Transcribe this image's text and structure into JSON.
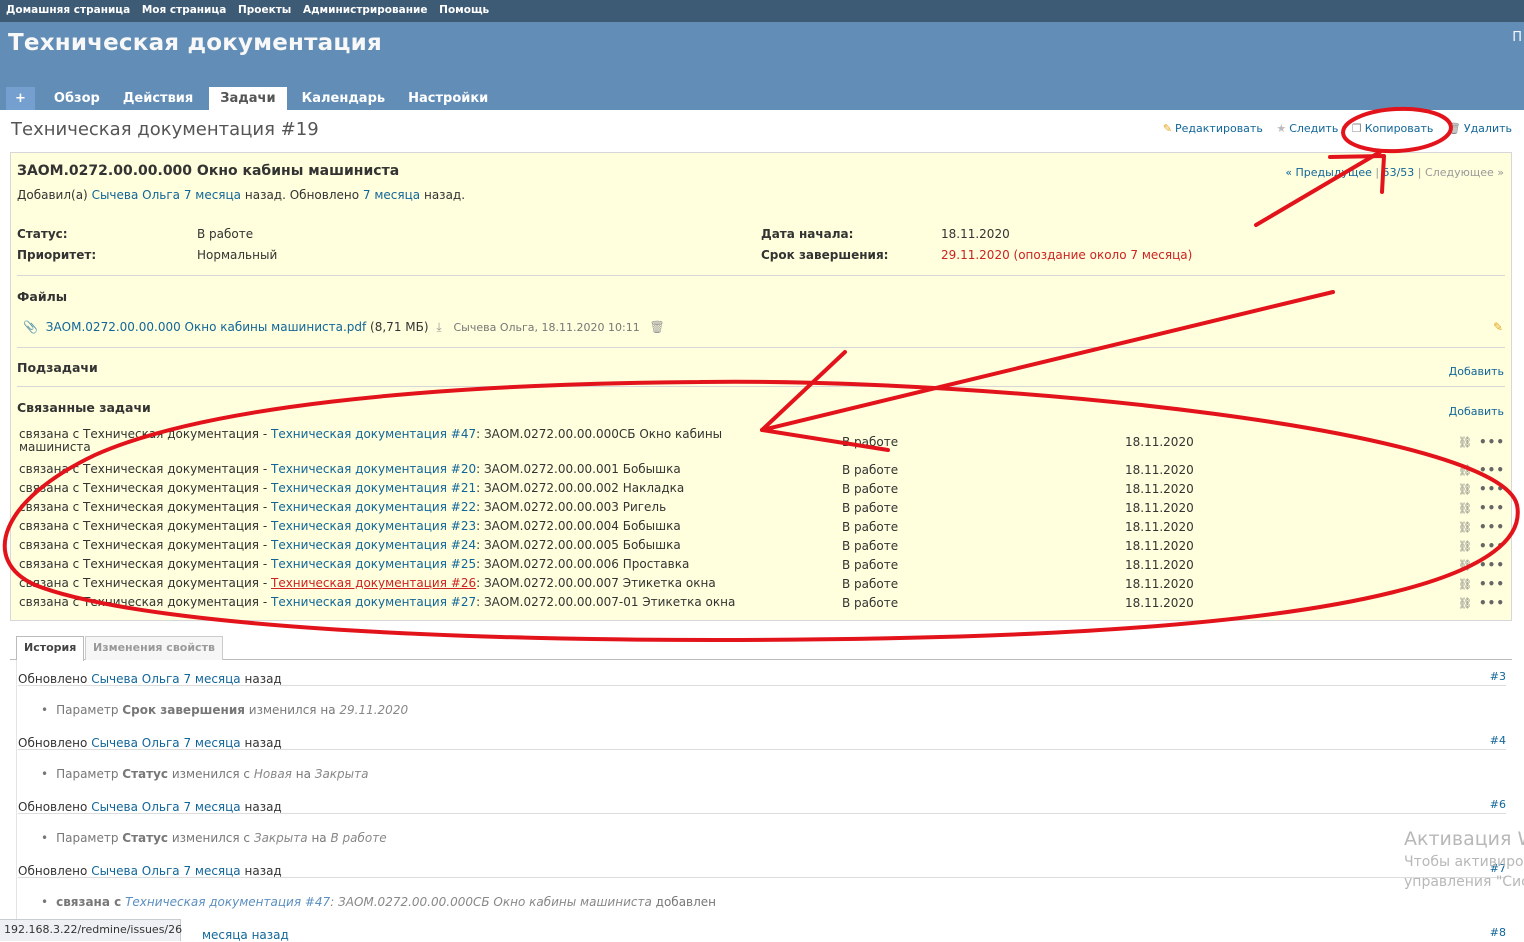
{
  "top_menu": {
    "items": [
      "Домашняя страница",
      "Моя страница",
      "Проекты",
      "Администрирование",
      "Помощь"
    ]
  },
  "header": {
    "project_title": "Техническая документация",
    "edge_text": "П",
    "tabs": [
      "+",
      "Обзор",
      "Действия",
      "Задачи",
      "Календарь",
      "Настройки"
    ],
    "active_tab": "Задачи"
  },
  "issue": {
    "page_title": "Техническая документация #19",
    "actions": {
      "edit": "Редактировать",
      "watch": "Следить",
      "copy": "Копировать",
      "delete": "Удалить"
    },
    "subject": "ЗАОМ.0272.00.00.000 Окно кабины машиниста",
    "nav": {
      "prev": "« Предыдущее",
      "sep1": "|",
      "position": "53/53",
      "sep2": "|",
      "next": "Следующее »"
    },
    "author": {
      "prefix": "Добавил(а)",
      "name": "Сычева Ольга",
      "created": "7 месяца",
      "mid": "назад. Обновлено",
      "updated": "7 месяца",
      "suffix": "назад."
    },
    "attributes": {
      "status_label": "Статус:",
      "status": "В работе",
      "priority_label": "Приоритет:",
      "priority": "Нормальный",
      "start_label": "Дата начала:",
      "start": "18.11.2020",
      "due_label": "Срок завершения:",
      "due": "29.11.2020 (опоздание около 7 месяца)"
    },
    "files": {
      "title": "Файлы",
      "name": "ЗАОМ.0272.00.00.000 Окно кабины машиниста.pdf",
      "size": "(8,71 МБ)",
      "meta": "Сычева Ольга, 18.11.2020 10:11"
    },
    "subtasks": {
      "title": "Подзадачи",
      "add": "Добавить"
    },
    "related": {
      "title": "Связанные задачи",
      "add": "Добавить",
      "rows": [
        {
          "rel": "связана с Техническая документация - ",
          "link": "Техническая документация #47",
          "subject": ": ЗАОМ.0272.00.00.000СБ Окно кабины",
          "subject2": "машиниста",
          "status": "В работе",
          "date": "18.11.2020"
        },
        {
          "rel": "связана с Техническая документация - ",
          "link": "Техническая документация #20",
          "subject": ": ЗАОМ.0272.00.00.001 Бобышка",
          "subject2": "",
          "status": "В работе",
          "date": "18.11.2020"
        },
        {
          "rel": "связана с Техническая документация - ",
          "link": "Техническая документация #21",
          "subject": ": ЗАОМ.0272.00.00.002 Накладка",
          "subject2": "",
          "status": "В работе",
          "date": "18.11.2020"
        },
        {
          "rel": "связана с Техническая документация - ",
          "link": "Техническая документация #22",
          "subject": ": ЗАОМ.0272.00.00.003 Ригель",
          "subject2": "",
          "status": "В работе",
          "date": "18.11.2020"
        },
        {
          "rel": "связана с Техническая документация - ",
          "link": "Техническая документация #23",
          "subject": ": ЗАОМ.0272.00.00.004 Бобышка",
          "subject2": "",
          "status": "В работе",
          "date": "18.11.2020"
        },
        {
          "rel": "связана с Техническая документация - ",
          "link": "Техническая документация #24",
          "subject": ": ЗАОМ.0272.00.00.005 Бобышка",
          "subject2": "",
          "status": "В работе",
          "date": "18.11.2020"
        },
        {
          "rel": "связана с Техническая документация - ",
          "link": "Техническая документация #25",
          "subject": ": ЗАОМ.0272.00.00.006 Проставка",
          "subject2": "",
          "status": "В работе",
          "date": "18.11.2020"
        },
        {
          "rel": "связана с Техническая документация - ",
          "link": "Техническая документация #26",
          "subject": ": ЗАОМ.0272.00.00.007 Этикетка окна",
          "subject2": "",
          "status": "В работе",
          "date": "18.11.2020"
        },
        {
          "rel": "связана с Техническая документация - ",
          "link": "Техническая документация #27",
          "subject": ": ЗАОМ.0272.00.00.007-01 Этикетка окна",
          "subject2": "",
          "status": "В работе",
          "date": "18.11.2020"
        }
      ]
    }
  },
  "history_tabs": [
    "История",
    "Изменения свойств"
  ],
  "journals": [
    {
      "prefix": "Обновлено",
      "user": "Сычева Ольга",
      "ago": "7 месяца",
      "suffix": "назад",
      "num": "#3",
      "d1": "Параметр",
      "d_field": "Срок завершения",
      "d_mid": "изменился на",
      "d_old": "",
      "d_mid2": "",
      "d_new": "29.11.2020"
    },
    {
      "prefix": "Обновлено",
      "user": "Сычева Ольга",
      "ago": "7 месяца",
      "suffix": "назад",
      "num": "#4",
      "d1": "Параметр",
      "d_field": "Статус",
      "d_mid": "изменился с",
      "d_old": "Новая",
      "d_mid2": "на",
      "d_new": "Закрыта"
    },
    {
      "prefix": "Обновлено",
      "user": "Сычева Ольга",
      "ago": "7 месяца",
      "suffix": "назад",
      "num": "#6",
      "d1": "Параметр",
      "d_field": "Статус",
      "d_mid": "изменился с",
      "d_old": "Закрыта",
      "d_mid2": "на",
      "d_new": "В работе"
    },
    {
      "prefix": "Обновлено",
      "user": "Сычева Ольга",
      "ago": "7 месяца",
      "suffix": "назад",
      "num": "#7",
      "rel_label": "связана с",
      "rel_link": "Техническая документация #47",
      "rel_subject": ": ЗАОМ.0272.00.00.000СБ Окно кабины машиниста",
      "rel_end": "добавлен"
    },
    {
      "partial": "месяца назад",
      "num": "#8"
    }
  ],
  "watermark": {
    "line1": "Активация W",
    "line2": "Чтобы активиров",
    "line3": "управления \"Сис"
  },
  "status_bar_url": "192.168.3.22/redmine/issues/26",
  "colors": {
    "top_menu": "#3e5b76",
    "header": "#628db6",
    "issue_bg": "#ffffdd",
    "link": "#169",
    "overdue": "#c22",
    "annotation": "#e3131b"
  }
}
